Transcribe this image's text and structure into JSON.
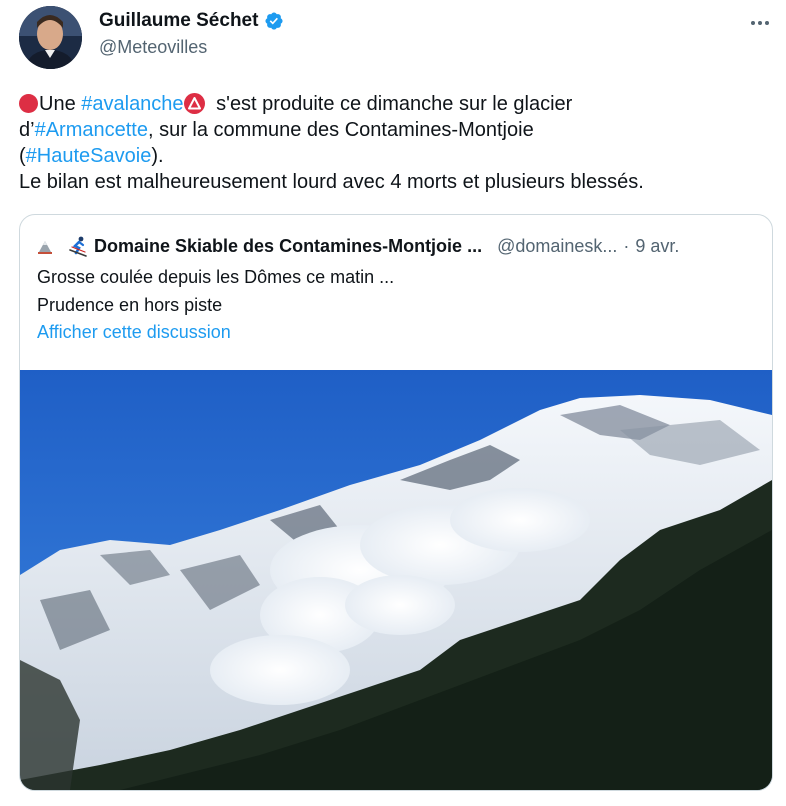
{
  "author": {
    "name": "Guillaume Séchet",
    "handle": "@Meteovilles"
  },
  "tweet": {
    "line1_text1": "Une ",
    "hashtag_avalanche": "#avalanche",
    "line1_text2": " s'est produite ce dimanche sur le glacier",
    "line2_text1": "d’",
    "hashtag_armancette": "#Armancette",
    "line2_text2": ", sur la commune des Contamines-Montjoie",
    "line3_open": "(",
    "hashtag_hautesavoie": "#HauteSavoie",
    "line3_close": ").",
    "line4": "Le bilan est malheureusement lourd avec 4 morts et plusieurs blessés."
  },
  "quote": {
    "name": "Domaine Skiable des Contamines-Montjoie ...",
    "handle": "@domainesk...",
    "separator": "·",
    "date": "9 avr.",
    "line1": "Grosse coulée depuis les Dômes ce matin ...",
    "line2": "Prudence en hors piste",
    "link": "Afficher cette discussion"
  },
  "colors": {
    "link": "#1d9bf0",
    "text": "#0f1419",
    "muted": "#536471",
    "border": "#cfd9de",
    "emoji_red": "#dd2e44"
  },
  "icons": [
    "verified-icon",
    "more-icon",
    "red-circle-emoji-icon",
    "warning-emoji-icon",
    "ski-icon"
  ]
}
